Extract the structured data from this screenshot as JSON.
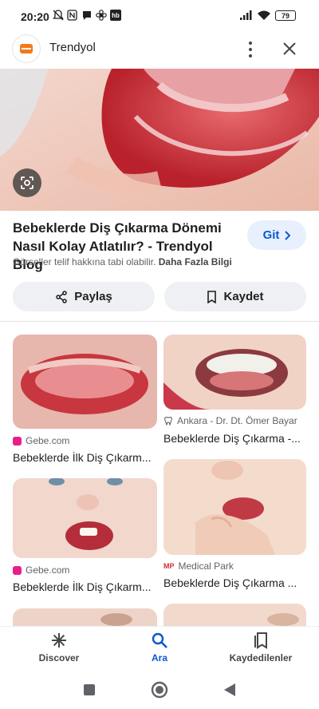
{
  "status_bar": {
    "time": "20:20",
    "battery": "79"
  },
  "top_bar": {
    "site_name": "Trendyol"
  },
  "result": {
    "title": "Bebeklerde Diş Çıkarma Dönemi Nasıl Kolay Atlatılır? - Trendyol Blog",
    "visit_label": "Git",
    "copyright_note": "Görseller telif hakkına tabi olabilir.",
    "more_info_label": "Daha Fazla Bilgi",
    "share_label": "Paylaş",
    "save_label": "Kaydet"
  },
  "related": [
    {
      "source": "Gebe.com",
      "title": "Bebeklerde İlk Diş Çıkarm...",
      "favicon_color": "#e91e8c"
    },
    {
      "source": "Ankara - Dr. Dt. Ömer Bayar",
      "title": "Bebeklerde Diş Çıkarma -...",
      "favicon_color": "#5f6368"
    },
    {
      "source": "Gebe.com",
      "title": "Bebeklerde İlk Diş Çıkarm...",
      "favicon_color": "#e91e8c"
    },
    {
      "source": "Medical Park",
      "title": "Bebeklerde Diş Çıkarma ...",
      "favicon_color": "#d32f2f",
      "favicon_text": "MP"
    }
  ],
  "bottom_nav": {
    "discover": "Discover",
    "search": "Ara",
    "saved": "Kaydedilenler"
  },
  "colors": {
    "accent": "#0b57d0",
    "brand": "#f27a1a"
  }
}
